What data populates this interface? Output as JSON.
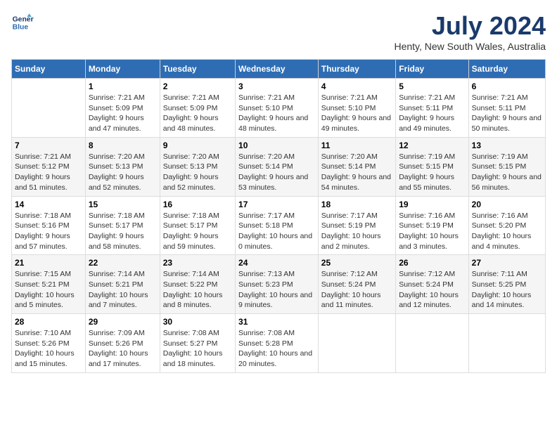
{
  "header": {
    "logo_line1": "General",
    "logo_line2": "Blue",
    "title": "July 2024",
    "subtitle": "Henty, New South Wales, Australia"
  },
  "columns": [
    "Sunday",
    "Monday",
    "Tuesday",
    "Wednesday",
    "Thursday",
    "Friday",
    "Saturday"
  ],
  "weeks": [
    [
      {
        "day": "",
        "sunrise": "",
        "sunset": "",
        "daylight": ""
      },
      {
        "day": "1",
        "sunrise": "Sunrise: 7:21 AM",
        "sunset": "Sunset: 5:09 PM",
        "daylight": "Daylight: 9 hours and 47 minutes."
      },
      {
        "day": "2",
        "sunrise": "Sunrise: 7:21 AM",
        "sunset": "Sunset: 5:09 PM",
        "daylight": "Daylight: 9 hours and 48 minutes."
      },
      {
        "day": "3",
        "sunrise": "Sunrise: 7:21 AM",
        "sunset": "Sunset: 5:10 PM",
        "daylight": "Daylight: 9 hours and 48 minutes."
      },
      {
        "day": "4",
        "sunrise": "Sunrise: 7:21 AM",
        "sunset": "Sunset: 5:10 PM",
        "daylight": "Daylight: 9 hours and 49 minutes."
      },
      {
        "day": "5",
        "sunrise": "Sunrise: 7:21 AM",
        "sunset": "Sunset: 5:11 PM",
        "daylight": "Daylight: 9 hours and 49 minutes."
      },
      {
        "day": "6",
        "sunrise": "Sunrise: 7:21 AM",
        "sunset": "Sunset: 5:11 PM",
        "daylight": "Daylight: 9 hours and 50 minutes."
      }
    ],
    [
      {
        "day": "7",
        "sunrise": "Sunrise: 7:21 AM",
        "sunset": "Sunset: 5:12 PM",
        "daylight": "Daylight: 9 hours and 51 minutes."
      },
      {
        "day": "8",
        "sunrise": "Sunrise: 7:20 AM",
        "sunset": "Sunset: 5:13 PM",
        "daylight": "Daylight: 9 hours and 52 minutes."
      },
      {
        "day": "9",
        "sunrise": "Sunrise: 7:20 AM",
        "sunset": "Sunset: 5:13 PM",
        "daylight": "Daylight: 9 hours and 52 minutes."
      },
      {
        "day": "10",
        "sunrise": "Sunrise: 7:20 AM",
        "sunset": "Sunset: 5:14 PM",
        "daylight": "Daylight: 9 hours and 53 minutes."
      },
      {
        "day": "11",
        "sunrise": "Sunrise: 7:20 AM",
        "sunset": "Sunset: 5:14 PM",
        "daylight": "Daylight: 9 hours and 54 minutes."
      },
      {
        "day": "12",
        "sunrise": "Sunrise: 7:19 AM",
        "sunset": "Sunset: 5:15 PM",
        "daylight": "Daylight: 9 hours and 55 minutes."
      },
      {
        "day": "13",
        "sunrise": "Sunrise: 7:19 AM",
        "sunset": "Sunset: 5:15 PM",
        "daylight": "Daylight: 9 hours and 56 minutes."
      }
    ],
    [
      {
        "day": "14",
        "sunrise": "Sunrise: 7:18 AM",
        "sunset": "Sunset: 5:16 PM",
        "daylight": "Daylight: 9 hours and 57 minutes."
      },
      {
        "day": "15",
        "sunrise": "Sunrise: 7:18 AM",
        "sunset": "Sunset: 5:17 PM",
        "daylight": "Daylight: 9 hours and 58 minutes."
      },
      {
        "day": "16",
        "sunrise": "Sunrise: 7:18 AM",
        "sunset": "Sunset: 5:17 PM",
        "daylight": "Daylight: 9 hours and 59 minutes."
      },
      {
        "day": "17",
        "sunrise": "Sunrise: 7:17 AM",
        "sunset": "Sunset: 5:18 PM",
        "daylight": "Daylight: 10 hours and 0 minutes."
      },
      {
        "day": "18",
        "sunrise": "Sunrise: 7:17 AM",
        "sunset": "Sunset: 5:19 PM",
        "daylight": "Daylight: 10 hours and 2 minutes."
      },
      {
        "day": "19",
        "sunrise": "Sunrise: 7:16 AM",
        "sunset": "Sunset: 5:19 PM",
        "daylight": "Daylight: 10 hours and 3 minutes."
      },
      {
        "day": "20",
        "sunrise": "Sunrise: 7:16 AM",
        "sunset": "Sunset: 5:20 PM",
        "daylight": "Daylight: 10 hours and 4 minutes."
      }
    ],
    [
      {
        "day": "21",
        "sunrise": "Sunrise: 7:15 AM",
        "sunset": "Sunset: 5:21 PM",
        "daylight": "Daylight: 10 hours and 5 minutes."
      },
      {
        "day": "22",
        "sunrise": "Sunrise: 7:14 AM",
        "sunset": "Sunset: 5:21 PM",
        "daylight": "Daylight: 10 hours and 7 minutes."
      },
      {
        "day": "23",
        "sunrise": "Sunrise: 7:14 AM",
        "sunset": "Sunset: 5:22 PM",
        "daylight": "Daylight: 10 hours and 8 minutes."
      },
      {
        "day": "24",
        "sunrise": "Sunrise: 7:13 AM",
        "sunset": "Sunset: 5:23 PM",
        "daylight": "Daylight: 10 hours and 9 minutes."
      },
      {
        "day": "25",
        "sunrise": "Sunrise: 7:12 AM",
        "sunset": "Sunset: 5:24 PM",
        "daylight": "Daylight: 10 hours and 11 minutes."
      },
      {
        "day": "26",
        "sunrise": "Sunrise: 7:12 AM",
        "sunset": "Sunset: 5:24 PM",
        "daylight": "Daylight: 10 hours and 12 minutes."
      },
      {
        "day": "27",
        "sunrise": "Sunrise: 7:11 AM",
        "sunset": "Sunset: 5:25 PM",
        "daylight": "Daylight: 10 hours and 14 minutes."
      }
    ],
    [
      {
        "day": "28",
        "sunrise": "Sunrise: 7:10 AM",
        "sunset": "Sunset: 5:26 PM",
        "daylight": "Daylight: 10 hours and 15 minutes."
      },
      {
        "day": "29",
        "sunrise": "Sunrise: 7:09 AM",
        "sunset": "Sunset: 5:26 PM",
        "daylight": "Daylight: 10 hours and 17 minutes."
      },
      {
        "day": "30",
        "sunrise": "Sunrise: 7:08 AM",
        "sunset": "Sunset: 5:27 PM",
        "daylight": "Daylight: 10 hours and 18 minutes."
      },
      {
        "day": "31",
        "sunrise": "Sunrise: 7:08 AM",
        "sunset": "Sunset: 5:28 PM",
        "daylight": "Daylight: 10 hours and 20 minutes."
      },
      {
        "day": "",
        "sunrise": "",
        "sunset": "",
        "daylight": ""
      },
      {
        "day": "",
        "sunrise": "",
        "sunset": "",
        "daylight": ""
      },
      {
        "day": "",
        "sunrise": "",
        "sunset": "",
        "daylight": ""
      }
    ]
  ]
}
